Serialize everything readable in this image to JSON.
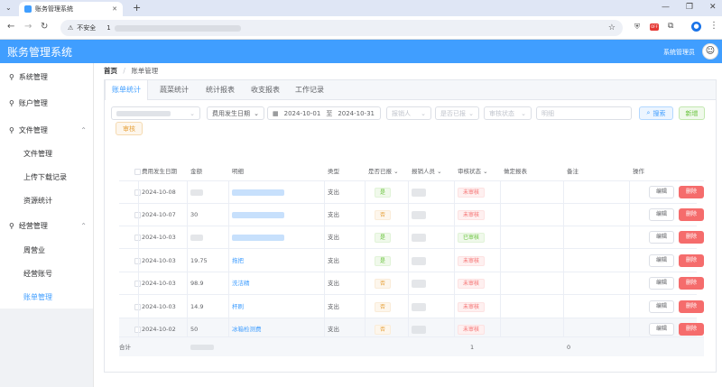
{
  "browser": {
    "tab_title": "账务管理系统",
    "insecure_label": "不安全",
    "url": "1",
    "ext_badge": "OFF"
  },
  "app": {
    "title": "账务管理系统",
    "user": "系统管理员"
  },
  "sidebar": {
    "items": [
      {
        "label": "系统管理"
      },
      {
        "label": "账户管理"
      },
      {
        "label": "文件管理"
      },
      {
        "label": "文件管理"
      },
      {
        "label": "上传下载记录"
      },
      {
        "label": "资源统计"
      },
      {
        "label": "经营管理"
      },
      {
        "label": "周营业"
      },
      {
        "label": "经营账号"
      },
      {
        "label": "账单管理"
      }
    ]
  },
  "breadcrumb": {
    "home": "首页",
    "sep": "/",
    "current": "账单管理"
  },
  "tabs": [
    "账单统计",
    "蔬菜统计",
    "统计报表",
    "收支报表",
    "工作记录"
  ],
  "filters": {
    "date_type": "费用发生日期",
    "start": "2024-10-01",
    "range_sep": "至",
    "end": "2024-10-31",
    "reporter": "报销人",
    "reported": "是否已报",
    "audit": "审核状态",
    "detail": "明细",
    "search_btn": "搜索",
    "add_btn": "新增",
    "audit_btn": "审核"
  },
  "table": {
    "headers": [
      "费用发生日期",
      "金额",
      "明细",
      "类型",
      "是否已报",
      "报销人员",
      "审核状态",
      "做定报表",
      "备注",
      "操作"
    ],
    "rows": [
      {
        "date": "2024-10-08",
        "amount": "",
        "detail": "",
        "type": "支出",
        "reported": "是",
        "status": "未审核"
      },
      {
        "date": "2024-10-07",
        "amount": "30",
        "detail": "",
        "type": "支出",
        "reported": "否",
        "status": "未审核"
      },
      {
        "date": "2024-10-03",
        "amount": "",
        "detail": "",
        "type": "支出",
        "reported": "是",
        "status": "已审核"
      },
      {
        "date": "2024-10-03",
        "amount": "19.75",
        "detail": "拖把",
        "type": "支出",
        "reported": "是",
        "status": "未审核"
      },
      {
        "date": "2024-10-03",
        "amount": "98.9",
        "detail": "洗洁精",
        "type": "支出",
        "reported": "否",
        "status": "未审核"
      },
      {
        "date": "2024-10-03",
        "amount": "14.9",
        "detail": "杯刷",
        "type": "支出",
        "reported": "否",
        "status": "未审核"
      },
      {
        "date": "2024-10-02",
        "amount": "50",
        "detail": "冰箱检测费",
        "type": "支出",
        "reported": "否",
        "status": "未审核"
      }
    ],
    "edit": "编辑",
    "delete": "删除",
    "footer": {
      "label": "合计",
      "amount": "",
      "audit_count": "1",
      "report_count": "0"
    }
  }
}
